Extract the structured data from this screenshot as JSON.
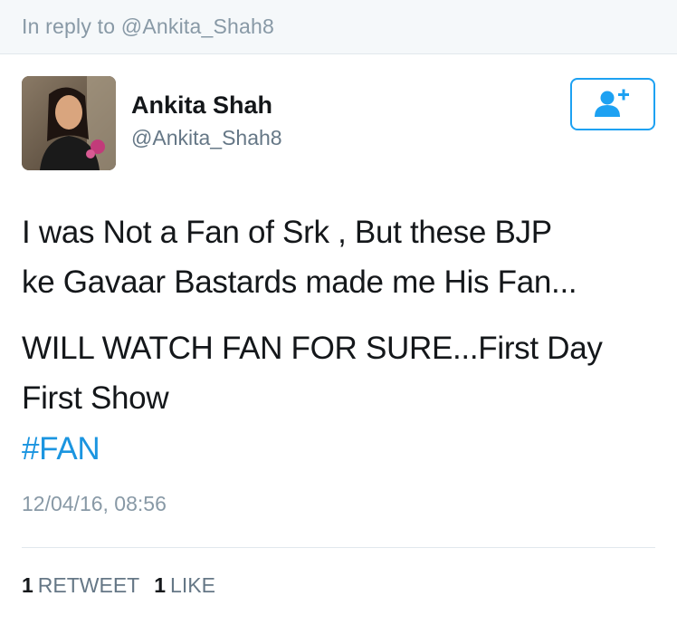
{
  "reply_bar": {
    "text": "In reply to @Ankita_Shah8"
  },
  "author": {
    "display_name": "Ankita Shah",
    "handle": "@Ankita_Shah8"
  },
  "follow_button": {
    "icon": "add-user-icon",
    "color": "#1da1f2"
  },
  "tweet": {
    "lines": [
      "I was Not a Fan of Srk , But these BJP",
      "ke Gavaar Bastards made me His Fan...",
      "WILL WATCH FAN FOR SURE...First Day",
      "First Show"
    ],
    "hashtag": "#FAN",
    "hashtag_color": "#1b95e0"
  },
  "timestamp": "12/04/16, 08:56",
  "stats": {
    "retweets": {
      "count": "1",
      "label": "RETWEET"
    },
    "likes": {
      "count": "1",
      "label": "LIKE"
    }
  }
}
